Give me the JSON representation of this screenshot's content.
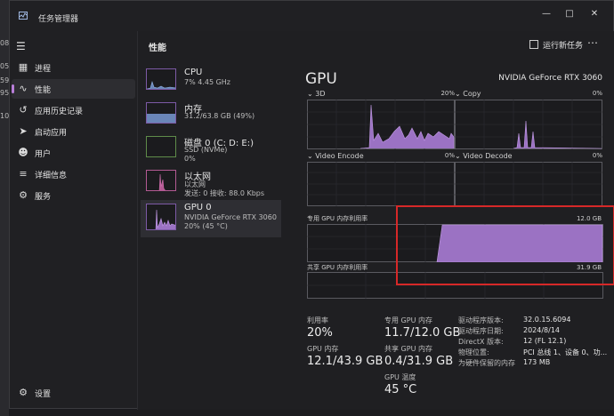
{
  "window": {
    "title": "任务管理器"
  },
  "left_strip": [
    "08",
    "05",
    "59",
    "95",
    "10"
  ],
  "sidebar": {
    "items": [
      {
        "label": "进程",
        "icon": "processes-icon"
      },
      {
        "label": "性能",
        "icon": "performance-icon",
        "active": true
      },
      {
        "label": "应用历史记录",
        "icon": "app-history-icon"
      },
      {
        "label": "启动应用",
        "icon": "startup-icon"
      },
      {
        "label": "用户",
        "icon": "users-icon"
      },
      {
        "label": "详细信息",
        "icon": "details-icon"
      },
      {
        "label": "服务",
        "icon": "services-icon"
      }
    ],
    "settings": "设置"
  },
  "header": {
    "title": "性能",
    "run_task": "运行新任务"
  },
  "devices": [
    {
      "name": "CPU",
      "sub1": "7% 4.45 GHz",
      "sub2": ""
    },
    {
      "name": "内存",
      "sub1": "31.2/63.8 GB (49%)",
      "sub2": ""
    },
    {
      "name": "磁盘 0 (C: D: E:)",
      "sub1": "SSD (NVMe)",
      "sub2": "0%"
    },
    {
      "name": "以太网",
      "sub1": "以太网",
      "sub2": "发送: 0 接收: 88.0 Kbps"
    },
    {
      "name": "GPU 0",
      "sub1": "NVIDIA GeForce RTX 3060",
      "sub2": "20% (45 °C)"
    }
  ],
  "gpu": {
    "title": "GPU",
    "model": "NVIDIA GeForce RTX 3060",
    "engines": [
      {
        "label": "3D",
        "pct": "20%"
      },
      {
        "label": "Copy",
        "pct": "0%"
      },
      {
        "label": "Video Encode",
        "pct": "0%"
      },
      {
        "label": "Video Decode",
        "pct": "0%"
      }
    ],
    "dedicated": {
      "label": "专用 GPU 内存利用率",
      "max": "12.0 GB",
      "level": 0.975
    },
    "shared": {
      "label": "共享 GPU 内存利用率",
      "max": "31.9 GB",
      "level": 0
    },
    "stats": {
      "util_k": "利用率",
      "util_v": "20%",
      "ded_k": "专用 GPU 内存",
      "ded_v": "11.7/12.0 GB",
      "mem_k": "GPU 内存",
      "mem_v": "12.1/43.9 GB",
      "sh_k": "共享 GPU 内存",
      "sh_v": "0.4/31.9 GB",
      "temp_k": "GPU 温度",
      "temp_v": "45 °C"
    },
    "info": [
      {
        "k": "驱动程序版本:",
        "v": "32.0.15.6094"
      },
      {
        "k": "驱动程序日期:",
        "v": "2024/8/14"
      },
      {
        "k": "DirectX 版本:",
        "v": "12 (FL 12.1)"
      },
      {
        "k": "物理位置:",
        "v": "PCI 总线 1、设备 0、功..."
      },
      {
        "k": "为硬件保留的内存",
        "v": "173 MB"
      }
    ]
  },
  "colors": {
    "accent": "#b87ed9",
    "graph_fill": "#9b72c3",
    "highlight": "#d62828"
  }
}
